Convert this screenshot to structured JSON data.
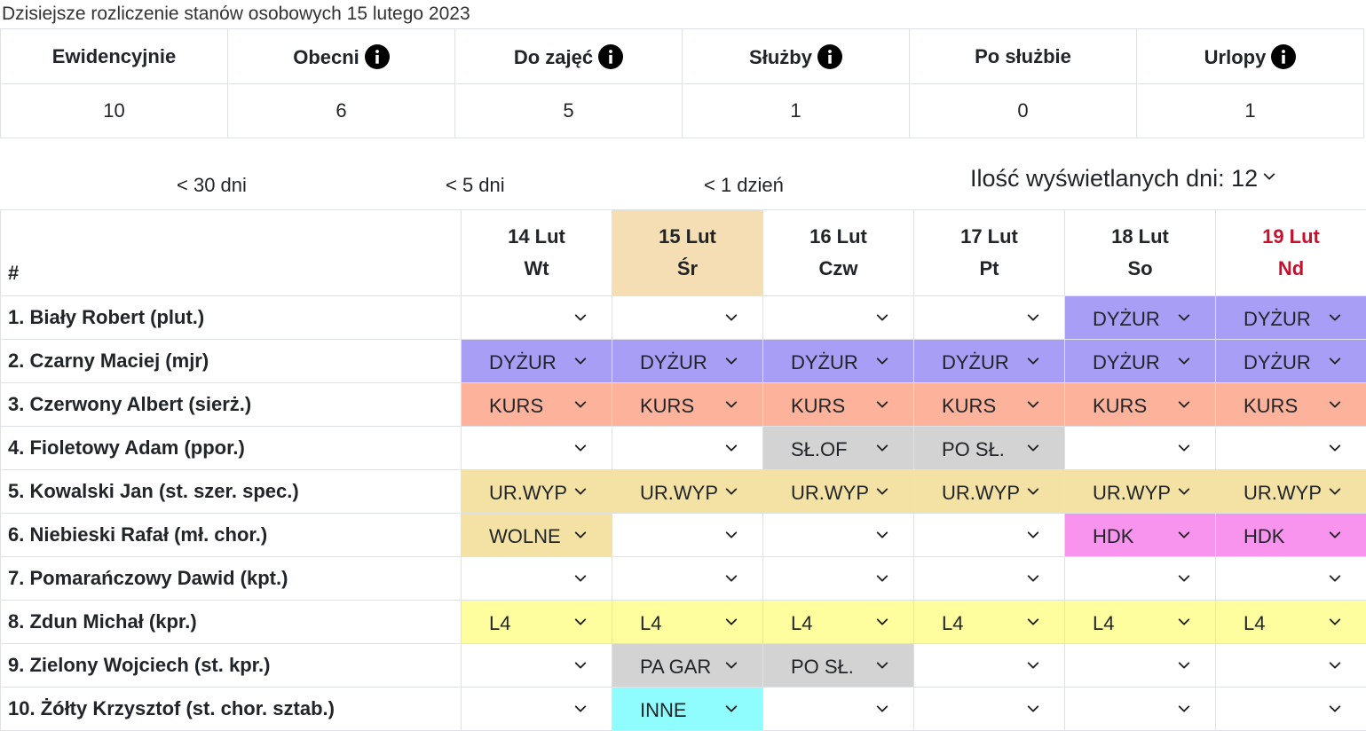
{
  "caption": "Dzisiejsze rozliczenie stanów osobowych 15 lutego 2023",
  "summary": {
    "headers": [
      "Ewidencyjnie",
      "Obecni",
      "Do zajęć",
      "Służby",
      "Po służbie",
      "Urlopy"
    ],
    "values": [
      "10",
      "6",
      "5",
      "1",
      "0",
      "1"
    ]
  },
  "nav": {
    "back30": "< 30 dni",
    "back5": "< 5 dni",
    "back1": "< 1 dzień"
  },
  "days_select": {
    "label": "Ilość wyświetlanych dni: 12"
  },
  "table": {
    "hash": "#",
    "days": [
      {
        "date": "14 Lut",
        "dow": "Wt"
      },
      {
        "date": "15 Lut",
        "dow": "Śr"
      },
      {
        "date": "16 Lut",
        "dow": "Czw"
      },
      {
        "date": "17 Lut",
        "dow": "Pt"
      },
      {
        "date": "18 Lut",
        "dow": "So"
      },
      {
        "date": "19 Lut",
        "dow": "Nd"
      }
    ],
    "rows": [
      {
        "name": "1. Biały Robert (plut.)",
        "cells": [
          "",
          "",
          "",
          "",
          "DYŻUR",
          "DYŻUR"
        ]
      },
      {
        "name": "2. Czarny Maciej (mjr)",
        "cells": [
          "DYŻUR",
          "DYŻUR",
          "DYŻUR",
          "DYŻUR",
          "DYŻUR",
          "DYŻUR"
        ]
      },
      {
        "name": "3. Czerwony Albert (sierż.)",
        "cells": [
          "KURS",
          "KURS",
          "KURS",
          "KURS",
          "KURS",
          "KURS"
        ]
      },
      {
        "name": "4. Fioletowy Adam (ppor.)",
        "cells": [
          "",
          "",
          "SŁ.OF",
          "PO SŁ.",
          "",
          ""
        ]
      },
      {
        "name": "5. Kowalski Jan (st. szer. spec.)",
        "cells": [
          "UR.WYP",
          "UR.WYP",
          "UR.WYP",
          "UR.WYP",
          "UR.WYP",
          "UR.WYP"
        ]
      },
      {
        "name": "6. Niebieski Rafał (mł. chor.)",
        "cells": [
          "WOLNE",
          "",
          "",
          "",
          "HDK",
          "HDK"
        ]
      },
      {
        "name": "7. Pomarańczowy Dawid (kpt.)",
        "cells": [
          "",
          "",
          "",
          "",
          "",
          ""
        ]
      },
      {
        "name": "8. Zdun Michał (kpr.)",
        "cells": [
          "L4",
          "L4",
          "L4",
          "L4",
          "L4",
          "L4"
        ]
      },
      {
        "name": "9. Zielony Wojciech (st. kpr.)",
        "cells": [
          "",
          "PA GAR",
          "PO SŁ.",
          "",
          "",
          ""
        ]
      },
      {
        "name": "10. Żółty Krzysztof (st. chor. sztab.)",
        "cells": [
          "",
          "INNE",
          "",
          "",
          "",
          ""
        ]
      }
    ]
  },
  "colors": {
    "DYŻUR": "#a89ef5",
    "KURS": "#fdb39b",
    "SŁ.OF": "#d3d3d3",
    "PO SŁ.": "#d3d3d3",
    "PA GAR": "#d3d3d3",
    "UR.WYP": "#f3e2a3",
    "WOLNE": "#f3e2a3",
    "HDK": "#f994ee",
    "L4": "#fefe9e",
    "INNE": "#8ffcfe",
    "today_header": "#f5deb3",
    "sunday_text": "#c8102e"
  },
  "icons": [
    "info-icon",
    "chevron-down-icon"
  ]
}
